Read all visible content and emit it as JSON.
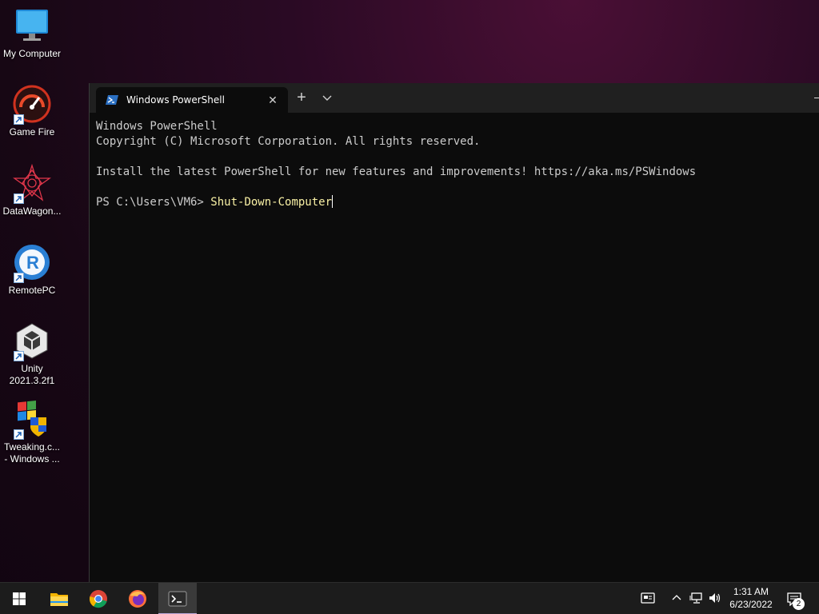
{
  "desktop": {
    "icons": [
      {
        "label": "My Computer",
        "icon": "monitor-icon"
      },
      {
        "label": "Game Fire",
        "icon": "speedometer-icon"
      },
      {
        "label": "DataWagon...",
        "icon": "fractal-star-icon"
      },
      {
        "label": "RemotePC",
        "icon": "remotepc-icon"
      },
      {
        "label": "Unity\n2021.3.2f1",
        "icon": "unity-icon"
      },
      {
        "label": "Tweaking.c...\n- Windows ...",
        "icon": "windows-shield-icon"
      }
    ]
  },
  "terminal": {
    "tab_title": "Windows PowerShell",
    "close_symbol": "✕",
    "new_tab_symbol": "+",
    "lines": [
      "Windows PowerShell",
      "Copyright (C) Microsoft Corporation. All rights reserved.",
      "",
      "Install the latest PowerShell for new features and improvements! https://aka.ms/PSWindows",
      ""
    ],
    "prompt": "PS C:\\Users\\VM6> ",
    "command": "Shut-Down-Computer"
  },
  "taskbar": {
    "apps": [
      "start-icon",
      "file-explorer-icon",
      "chrome-icon",
      "firefox-icon",
      "terminal-icon"
    ],
    "time": "1:31 AM",
    "date": "6/23/2022",
    "notification_count": "2"
  },
  "colors": {
    "console_bg": "#0c0c0c",
    "console_text": "#cccccc",
    "command_text": "#f9f1a5",
    "taskbar_bg": "#1c1c1c"
  }
}
